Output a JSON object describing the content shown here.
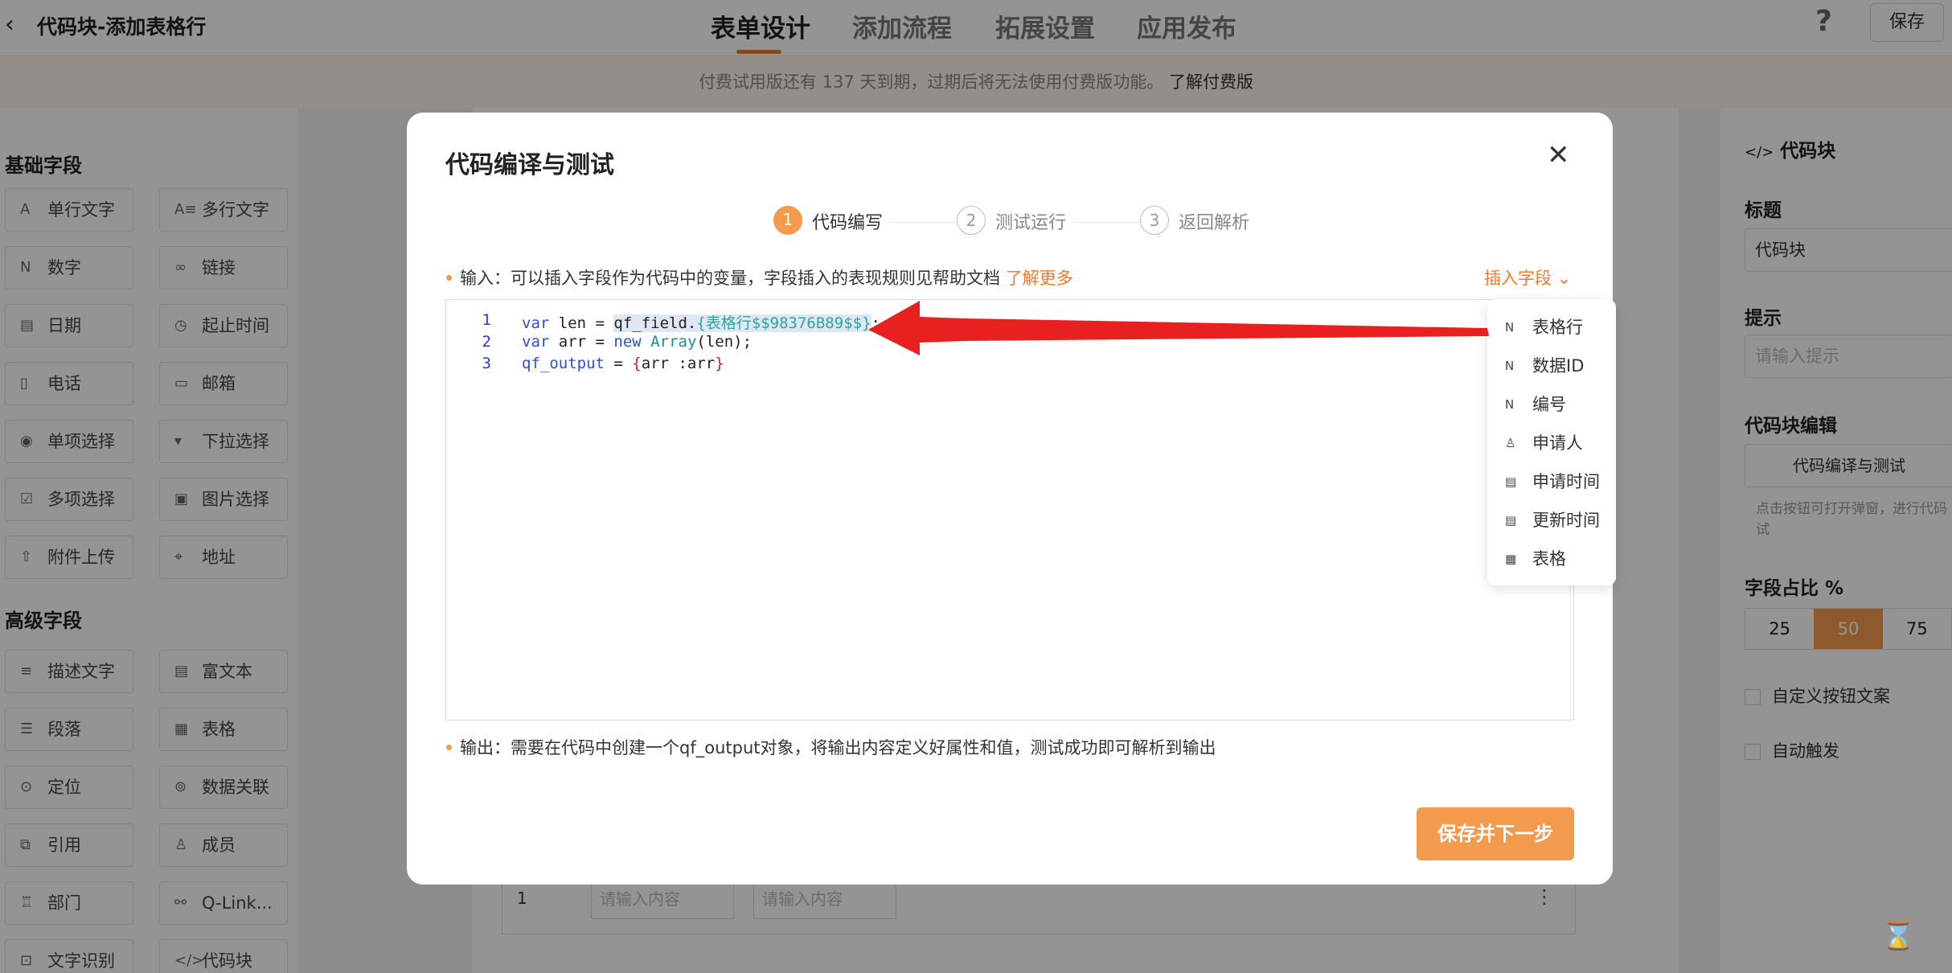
{
  "header": {
    "title": "代码块-添加表格行",
    "tabs": [
      "表单设计",
      "添加流程",
      "拓展设置",
      "应用发布"
    ],
    "save": "保存",
    "help": "?"
  },
  "notice": {
    "text": "付费试用版还有 137 天到期，过期后将无法使用付费版功能。",
    "link": "了解付费版"
  },
  "left": {
    "basic_title": "基础字段",
    "basic": [
      {
        "label": "单行文字",
        "icon": "A"
      },
      {
        "label": "多行文字",
        "icon": "A≡"
      },
      {
        "label": "数字",
        "icon": "N"
      },
      {
        "label": "链接",
        "icon": "∞"
      },
      {
        "label": "日期",
        "icon": "▤"
      },
      {
        "label": "起止时间",
        "icon": "◷"
      },
      {
        "label": "电话",
        "icon": "▯"
      },
      {
        "label": "邮箱",
        "icon": "▭"
      },
      {
        "label": "单项选择",
        "icon": "◉"
      },
      {
        "label": "下拉选择",
        "icon": "▾"
      },
      {
        "label": "多项选择",
        "icon": "☑"
      },
      {
        "label": "图片选择",
        "icon": "▣"
      },
      {
        "label": "附件上传",
        "icon": "⇧"
      },
      {
        "label": "地址",
        "icon": "⌖"
      }
    ],
    "adv_title": "高级字段",
    "advanced": [
      {
        "label": "描述文字",
        "icon": "≡"
      },
      {
        "label": "富文本",
        "icon": "▤"
      },
      {
        "label": "段落",
        "icon": "☰"
      },
      {
        "label": "表格",
        "icon": "▦"
      },
      {
        "label": "定位",
        "icon": "⊙"
      },
      {
        "label": "数据关联",
        "icon": "⊚"
      },
      {
        "label": "引用",
        "icon": "⧉"
      },
      {
        "label": "成员",
        "icon": "♙"
      },
      {
        "label": "部门",
        "icon": "♖"
      },
      {
        "label": "Q-Link...",
        "icon": "⚯"
      },
      {
        "label": "文字识别",
        "icon": "⊡"
      },
      {
        "label": "代码块",
        "icon": "</>"
      }
    ]
  },
  "canvas": {
    "row_num": "1",
    "input_placeholder": "请输入内容",
    "input_placeholder2": "请输入内容"
  },
  "right": {
    "title": "代码块",
    "label_title": "标题",
    "title_value": "代码块",
    "hint_title": "提示",
    "hint_placeholder": "请输入提示",
    "edit_title": "代码块编辑",
    "edit_btn": "代码编译与测试",
    "edit_note1": "点击按钮可打开弹窗，进行代码",
    "edit_note2": "试",
    "ratio_title": "字段占比 %",
    "ratios": [
      "25",
      "50",
      "75"
    ],
    "custom_btn": "自定义按钮文案",
    "auto_trigger": "自动触发"
  },
  "modal": {
    "title": "代码编译与测试",
    "steps": [
      {
        "num": "1",
        "label": "代码编写"
      },
      {
        "num": "2",
        "label": "测试运行"
      },
      {
        "num": "3",
        "label": "返回解析"
      }
    ],
    "input_desc": "输入：可以插入字段作为代码中的变量，字段插入的表现规则见帮助文档",
    "learn_more": "了解更多",
    "insert_field": "插入字段",
    "code_lines": [
      "1",
      "2",
      "3"
    ],
    "code": {
      "l1_var": "var",
      "l1_a": " len = ",
      "l1_field": "qf_field.",
      "l1_tag": "{表格行$$98376B89$$}",
      "l1_end": ";",
      "l2_var": "var",
      "l2_a": " arr = ",
      "l2_new": "new",
      "l2_sp": " ",
      "l2_array": "Array",
      "l2_b": "(len);",
      "l3_out": "qf_output",
      "l3_a": " = ",
      "l3_ob": "{",
      "l3_b": "arr :arr",
      "l3_cb": "}"
    },
    "output_desc": "输出：需要在代码中创建一个qf_output对象，将输出内容定义好属性和值，测试成功即可解析到输出",
    "submit": "保存并下一步",
    "dropdown": [
      {
        "label": "表格行",
        "icon": "N"
      },
      {
        "label": "数据ID",
        "icon": "N"
      },
      {
        "label": "编号",
        "icon": "N"
      },
      {
        "label": "申请人",
        "icon": "♙"
      },
      {
        "label": "申请时间",
        "icon": "▤"
      },
      {
        "label": "更新时间",
        "icon": "▤"
      },
      {
        "label": "表格",
        "icon": "▦"
      }
    ]
  },
  "colors": {
    "accent": "#f49a4c",
    "arrow": "#e8201f"
  }
}
